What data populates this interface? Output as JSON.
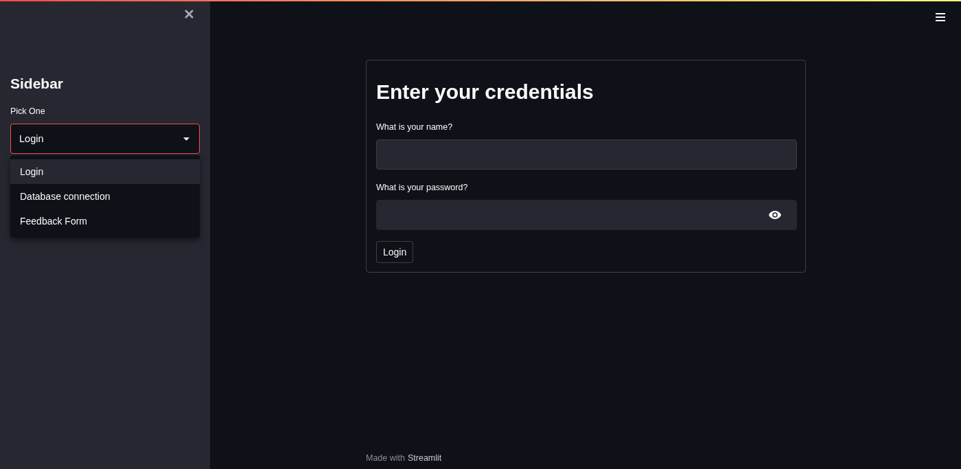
{
  "sidebar": {
    "title": "Sidebar",
    "select": {
      "label": "Pick One",
      "value": "Login",
      "expanded": true,
      "options": [
        {
          "label": "Login",
          "selected": true
        },
        {
          "label": "Database connection",
          "selected": false
        },
        {
          "label": "Feedback Form",
          "selected": false
        }
      ]
    }
  },
  "form": {
    "title": "Enter your credentials",
    "fields": [
      {
        "kind": "text",
        "label": "What is your name?"
      },
      {
        "kind": "password",
        "label": "What is your password?"
      }
    ],
    "submit": "Login"
  },
  "footer": {
    "text": "Made with",
    "link": "Streamlit"
  }
}
